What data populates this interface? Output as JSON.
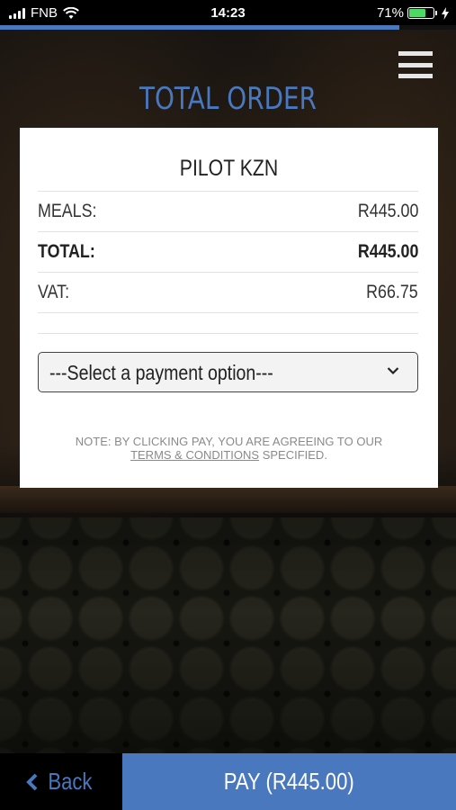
{
  "status_bar": {
    "carrier": "FNB",
    "time": "14:23",
    "battery_percent": "71%",
    "battery_level": 0.71,
    "signal_icon": "signal-bars-icon",
    "wifi_icon": "wifi-icon",
    "charging_icon": "bolt-icon"
  },
  "page_progress": 0.875,
  "header": {
    "title": "TOTAL ORDER",
    "menu_icon": "hamburger-menu-icon"
  },
  "receipt": {
    "merchant": "PILOT KZN",
    "rows": [
      {
        "label": "MEALS:",
        "value": "R445.00"
      },
      {
        "label": "TOTAL:",
        "value": "R445.00"
      },
      {
        "label": "VAT:",
        "value": "R66.75"
      }
    ],
    "payment_select": {
      "selected": "---Select a payment option---"
    },
    "note": {
      "prefix": "NOTE: BY CLICKING PAY, YOU ARE AGREEING TO OUR ",
      "link": "TERMS & CONDITIONS",
      "suffix": " SPECIFIED."
    }
  },
  "footer": {
    "back_label": "Back",
    "pay_label": "PAY (R445.00)"
  },
  "colors": {
    "accent": "#4a78bf",
    "battery": "#4cd964"
  }
}
